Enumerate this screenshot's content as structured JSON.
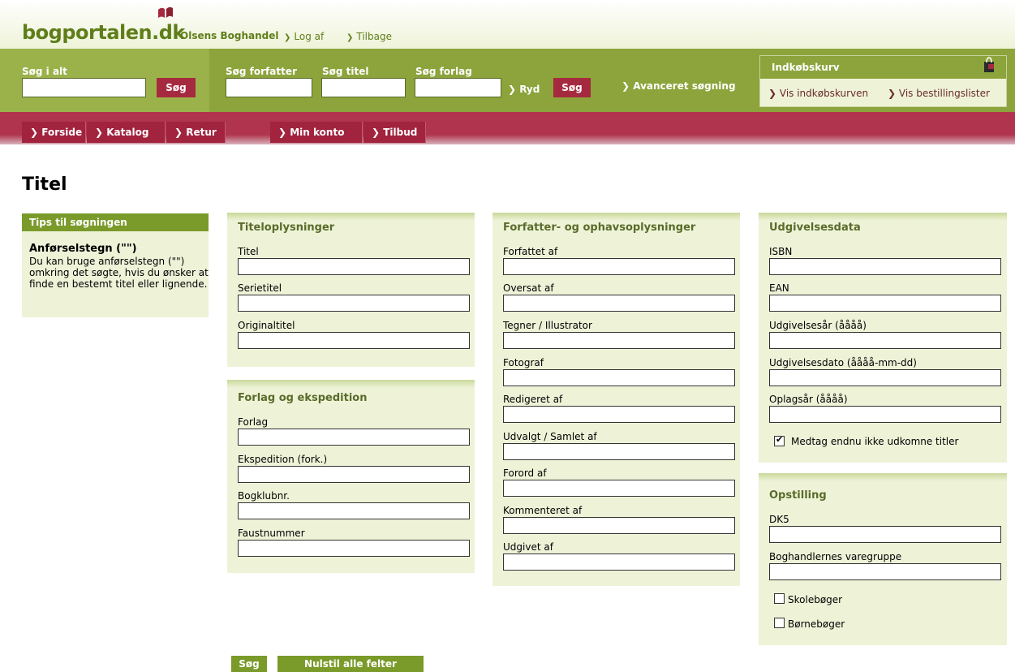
{
  "header": {
    "logo": "bogportalen.dk",
    "shop_name": "Olsens Boghandel",
    "links": [
      "Log af",
      "Tilbage"
    ]
  },
  "searchbar": {
    "search_all_label": "Søg i alt",
    "search_button": "Søg",
    "author_label": "Søg forfatter",
    "title_label": "Søg titel",
    "publisher_label": "Søg forlag",
    "clear_link": "Ryd",
    "search_button2": "Søg",
    "advanced_link": "Avanceret søgning"
  },
  "cart": {
    "title": "Indkøbskurv",
    "link_view_cart": "Vis indkøbskurven",
    "link_order_lists": "Vis bestillingslister"
  },
  "nav": [
    "Forside",
    "Katalog",
    "Retur",
    "Min konto",
    "Tilbud"
  ],
  "page_title": "Titel",
  "tips": {
    "title": "Tips til søgningen",
    "subtitle": "Anførselstegn (\"\")",
    "body": "Du kan bruge anførselstegn (\"\") omkring det søgte, hvis du ønsker at finde en bestemt titel eller lignende."
  },
  "panels": {
    "titel": {
      "title": "Titeloplysninger",
      "fields": [
        "Titel",
        "Serietitel",
        "Originaltitel"
      ]
    },
    "forlag": {
      "title": "Forlag og ekspedition",
      "fields": [
        "Forlag",
        "Ekspedition (fork.)",
        "Bogklubnr.",
        "Faustnummer"
      ]
    },
    "forfatter": {
      "title": "Forfatter- og ophavsoplysninger",
      "fields": [
        "Forfattet af",
        "Oversat af",
        "Tegner / Illustrator",
        "Fotograf",
        "Redigeret af",
        "Udvalgt / Samlet af",
        "Forord af",
        "Kommenteret af",
        "Udgivet af"
      ]
    },
    "udgivelse": {
      "title": "Udgivelsesdata",
      "fields": [
        "ISBN",
        "EAN",
        "Udgivelsesår (åååå)",
        "Udgivelsesdato (åååå-mm-dd)",
        "Oplagsår (åååå)"
      ],
      "checkbox": {
        "label": "Medtag endnu ikke udkomne titler",
        "checked": true
      }
    },
    "opstilling": {
      "title": "Opstilling",
      "fields": [
        "DK5",
        "Boghandlernes varegruppe"
      ],
      "checkboxes": [
        {
          "label": "Skolebøger",
          "checked": false
        },
        {
          "label": "Børnebøger",
          "checked": false
        }
      ]
    }
  },
  "buttons": {
    "search": "Søg",
    "reset": "Nulstil alle felter"
  },
  "colors": {
    "green_dark": "#7a9a2a",
    "green_bar": "#8ca43b",
    "panel_bg": "#eef3d8",
    "red_bar": "#b0344e",
    "red_button": "#a62a3f"
  }
}
